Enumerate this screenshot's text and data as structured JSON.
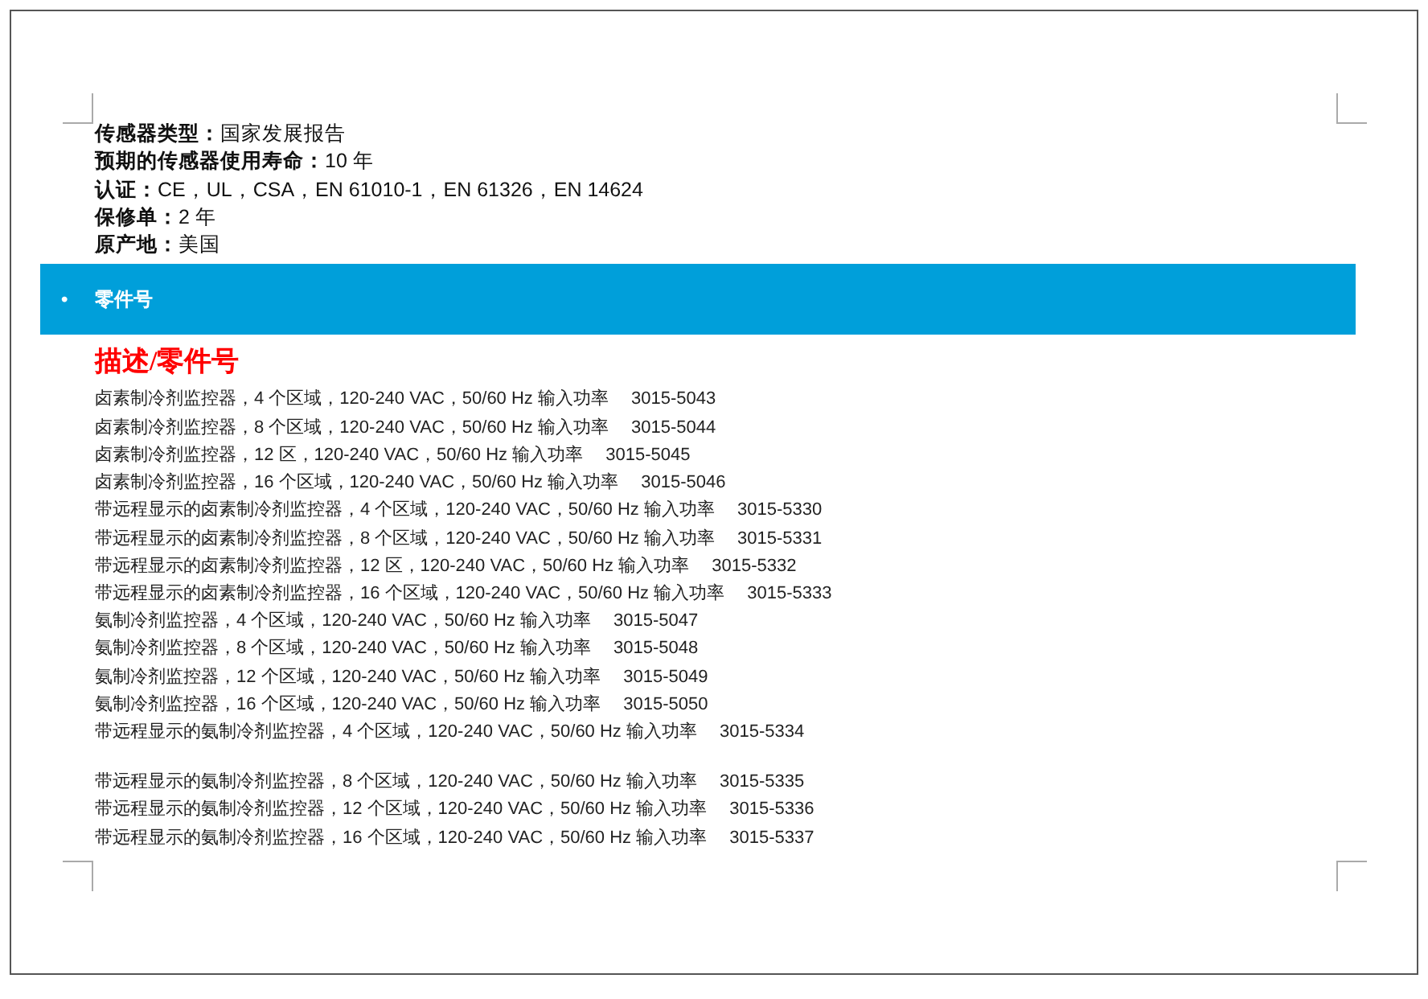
{
  "specs": [
    "**传感器类型：**国家发展报告",
    "**预期的传感器使用寿命：**10 年",
    "**认证：**CE，UL，CSA，EN 61010-1，EN 61326，EN 14624",
    "**保修单：**2 年",
    "**原产地：**美国"
  ],
  "section_bar": {
    "bullet": "•",
    "title": "零件号"
  },
  "heading": "描述/零件号",
  "part_groups": [
    [
      {
        "description": "卤素制冷剂监控器，4 个区域，120-240 VAC，50/60 Hz 输入功率",
        "part_number": "3015-5043"
      },
      {
        "description": "卤素制冷剂监控器，8 个区域，120-240 VAC，50/60 Hz 输入功率",
        "part_number": "3015-5044"
      },
      {
        "description": "卤素制冷剂监控器，12 区，120-240 VAC，50/60 Hz 输入功率",
        "part_number": "3015-5045"
      },
      {
        "description": "卤素制冷剂监控器，16 个区域，120-240 VAC，50/60 Hz 输入功率",
        "part_number": "3015-5046"
      },
      {
        "description": "带远程显示的卤素制冷剂监控器，4 个区域，120-240 VAC，50/60 Hz 输入功率",
        "part_number": "3015-5330"
      },
      {
        "description": "带远程显示的卤素制冷剂监控器，8 个区域，120-240 VAC，50/60 Hz 输入功率",
        "part_number": "3015-5331"
      },
      {
        "description": "带远程显示的卤素制冷剂监控器，12 区，120-240 VAC，50/60 Hz 输入功率",
        "part_number": "3015-5332"
      },
      {
        "description": "带远程显示的卤素制冷剂监控器，16 个区域，120-240 VAC，50/60 Hz 输入功率",
        "part_number": "3015-5333"
      },
      {
        "description": "氨制冷剂监控器，4 个区域，120-240 VAC，50/60 Hz 输入功率",
        "part_number": "3015-5047"
      },
      {
        "description": "氨制冷剂监控器，8 个区域，120-240 VAC，50/60 Hz 输入功率",
        "part_number": "3015-5048"
      },
      {
        "description": "氨制冷剂监控器，12 个区域，120-240 VAC，50/60 Hz 输入功率",
        "part_number": "3015-5049"
      },
      {
        "description": "氨制冷剂监控器，16 个区域，120-240 VAC，50/60 Hz 输入功率",
        "part_number": "3015-5050"
      },
      {
        "description": "带远程显示的氨制冷剂监控器，4 个区域，120-240 VAC，50/60 Hz 输入功率",
        "part_number": "3015-5334"
      }
    ],
    [
      {
        "description": "带远程显示的氨制冷剂监控器，8 个区域，120-240 VAC，50/60 Hz 输入功率",
        "part_number": "3015-5335"
      },
      {
        "description": "带远程显示的氨制冷剂监控器，12 个区域，120-240 VAC，50/60 Hz 输入功率",
        "part_number": "3015-5336"
      },
      {
        "description": "带远程显示的氨制冷剂监控器，16 个区域，120-240 VAC，50/60 Hz 输入功率",
        "part_number": "3015-5337"
      }
    ]
  ]
}
